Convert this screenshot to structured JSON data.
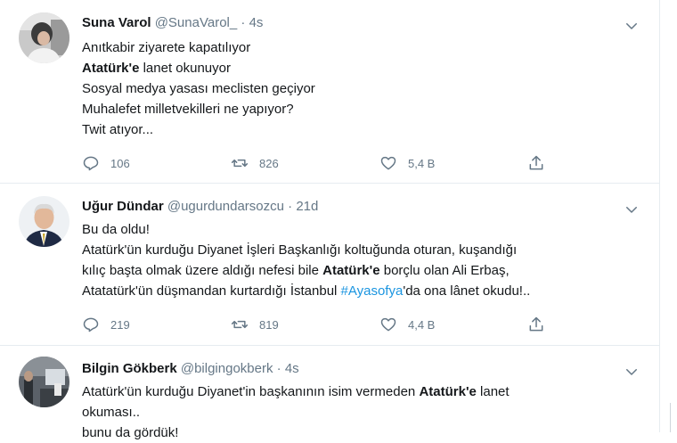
{
  "colors": {
    "accent": "#1b95e0",
    "muted": "#657786",
    "text": "#14171a",
    "border": "#e6ecf0"
  },
  "tweets": [
    {
      "display_name": "Suna Varol",
      "handle": "@SunaVarol_",
      "separator": "·",
      "time": "4s",
      "lines": [
        "Anıtkabir ziyarete kapatılıyor",
        [
          "Atatürk'e",
          " lanet okunuyor"
        ],
        "Sosyal medya yasası meclisten geçiyor",
        "Muhalefet milletvekilleri ne yapıyor?",
        "Twit atıyor..."
      ],
      "replies": "106",
      "retweets": "826",
      "likes": "5,4 B",
      "icons": [
        "reply-icon",
        "retweet-icon",
        "like-icon",
        "share-icon",
        "chevron-down-icon"
      ]
    },
    {
      "display_name": "Uğur Dündar",
      "handle": "@ugurdundarsozcu",
      "separator": "·",
      "time": "21d",
      "lines": [
        "Bu da oldu!",
        "Atatürk'ün kurduğu Diyanet İşleri Başkanlığı koltuğunda oturan, kuşandığı",
        [
          "kılıç başta olmak üzere aldığı nefesi bile ",
          "Atatürk'e",
          " borçlu olan Ali Erbaş,"
        ],
        [
          "Atatatürk'ün düşmandan kurtardığı İstanbul ",
          "#Ayasofya",
          "'da ona lânet okudu!.."
        ]
      ],
      "replies": "219",
      "retweets": "819",
      "likes": "4,4 B",
      "icons": [
        "reply-icon",
        "retweet-icon",
        "like-icon",
        "share-icon",
        "chevron-down-icon"
      ]
    },
    {
      "display_name": "Bilgin Gökberk",
      "handle": "@bilgingokberk",
      "separator": "·",
      "time": "4s",
      "lines": [
        [
          "Atatürk'ün kurduğu Diyanet'in başkanının isim vermeden ",
          "Atatürk'e",
          " lanet"
        ],
        "okuması..",
        "bunu da gördük!"
      ],
      "icons": [
        "chevron-down-icon"
      ]
    }
  ]
}
